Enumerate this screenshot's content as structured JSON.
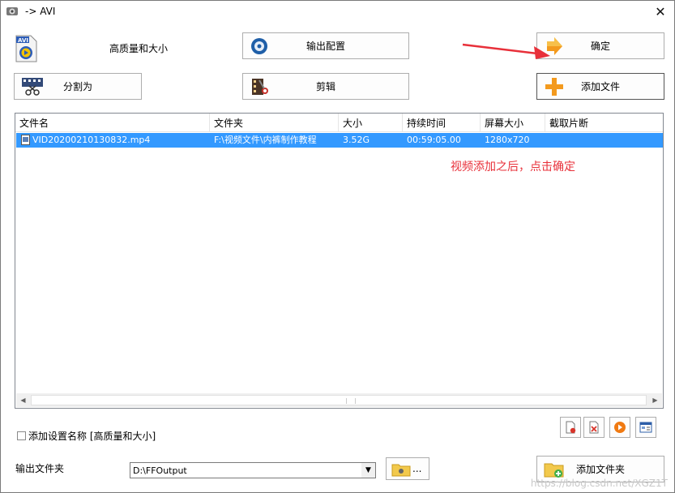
{
  "window": {
    "title": "-> AVI",
    "close_glyph": "✕"
  },
  "profile": {
    "name": "高质量和大小",
    "icon": "avi-file-icon"
  },
  "buttons": {
    "output_config": "输出配置",
    "ok": "确定",
    "split": "分割为",
    "clip": "剪辑",
    "add_file": "添加文件"
  },
  "table": {
    "columns": [
      "文件名",
      "文件夹",
      "大小",
      "持续时间",
      "屏幕大小",
      "截取片断"
    ],
    "rows": [
      {
        "filename": "VID20200210130832.mp4",
        "folder": "F:\\视频文件\\内裤制作教程",
        "size": "3.52G",
        "duration": "00:59:05.00",
        "screen": "1280x720",
        "clip": ""
      }
    ]
  },
  "annotation": "视频添加之后，点击确定",
  "settings": {
    "add_setting_name_label": "添加设置名称 [高质量和大小]"
  },
  "output": {
    "folder_label": "输出文件夹",
    "folder_value": "D:\\FFOutput",
    "browse_label": "...",
    "add_folder_button": "添加文件夹"
  },
  "watermark": "https://blog.csdn.net/XGZ1T",
  "colors": {
    "selection": "#3399ff",
    "annotation": "#e8303a",
    "arrow": "#e8303a"
  }
}
